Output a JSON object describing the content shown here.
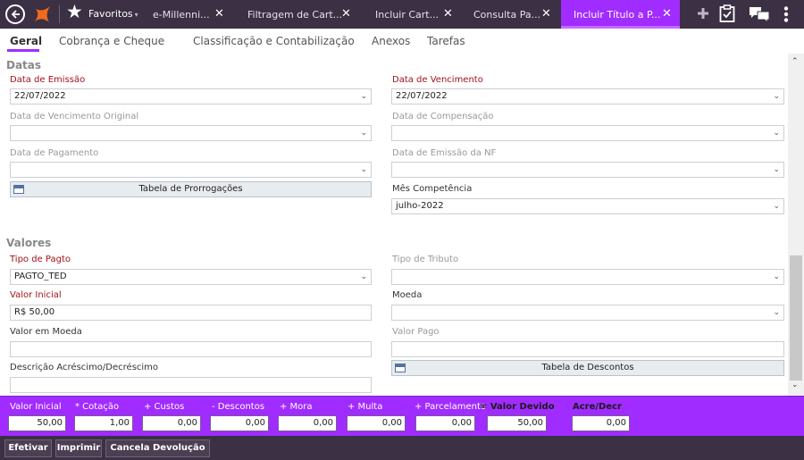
{
  "topbar": {
    "favorites_label": "Favoritos",
    "favorites_caret": "▾",
    "tabs": [
      {
        "label": "e-Millenni..."
      },
      {
        "label": "Filtragem de Cart..."
      },
      {
        "label": "Incluir Cart..."
      },
      {
        "label": "Consulta Pa..."
      },
      {
        "label": "Incluir Título a P..."
      }
    ],
    "close_glyph": "✕",
    "icons": [
      "back-icon",
      "logo-icon",
      "star-icon",
      "plus-icon",
      "clipboard-check-icon",
      "chat-icon",
      "more-vertical-icon"
    ],
    "accent": "#a02cff",
    "bar_color": "#3b3044"
  },
  "subtabs": [
    {
      "label": "Geral"
    },
    {
      "label": "Cobrança e Cheque"
    },
    {
      "label": "Classificação e Contabilização"
    },
    {
      "label": "Anexos"
    },
    {
      "label": "Tarefas"
    }
  ],
  "datas": {
    "section_title": "Datas",
    "data_emissao": {
      "label": "Data de Emissão",
      "value": "22/07/2022"
    },
    "data_vencimento": {
      "label": "Data de Vencimento",
      "value": "22/07/2022"
    },
    "data_venc_original": {
      "label": "Data de Vencimento Original",
      "value": ""
    },
    "data_compensacao": {
      "label": "Data de Compensação",
      "value": ""
    },
    "data_pagamento": {
      "label": "Data de Pagamento",
      "value": ""
    },
    "data_emissao_nf": {
      "label": "Data de Emissão da NF",
      "value": ""
    },
    "tabela_prorrogacoes": "Tabela de Prorrogações",
    "mes_competencia": {
      "label": "Mês Competência",
      "value": "julho-2022"
    }
  },
  "valores": {
    "section_title": "Valores",
    "tipo_pagto": {
      "label": "Tipo de Pagto",
      "value": "PAGTO_TED"
    },
    "tipo_tributo": {
      "label": "Tipo de Tributo",
      "value": ""
    },
    "valor_inicial": {
      "label": "Valor Inicial",
      "value": "R$ 50,00"
    },
    "moeda": {
      "label": "Moeda",
      "value": ""
    },
    "valor_moeda": {
      "label": "Valor em Moeda",
      "value": ""
    },
    "valor_pago": {
      "label": "Valor Pago",
      "value": ""
    },
    "descricao": {
      "label": "Descrição Acréscimo/Decréscimo",
      "value": ""
    },
    "tabela_descontos": "Tabela de Descontos"
  },
  "totals": [
    {
      "label": "Valor Inicial",
      "value": "50,00"
    },
    {
      "label": "* Cotação",
      "value": "1,00"
    },
    {
      "label": "+ Custos",
      "value": "0,00"
    },
    {
      "label": "- Descontos",
      "value": "0,00"
    },
    {
      "label": "+ Mora",
      "value": "0,00"
    },
    {
      "label": "+ Multa",
      "value": "0,00"
    },
    {
      "label": "+ Parcelamento",
      "value": "0,00"
    },
    {
      "label": "= Valor Devido",
      "value": "50,00"
    },
    {
      "label": "Acre/Decr",
      "value": "0,00"
    }
  ],
  "bottom_buttons": {
    "efetivar": "Efetivar",
    "imprimir": "Imprimir",
    "cancela": "Cancela Devolução"
  }
}
